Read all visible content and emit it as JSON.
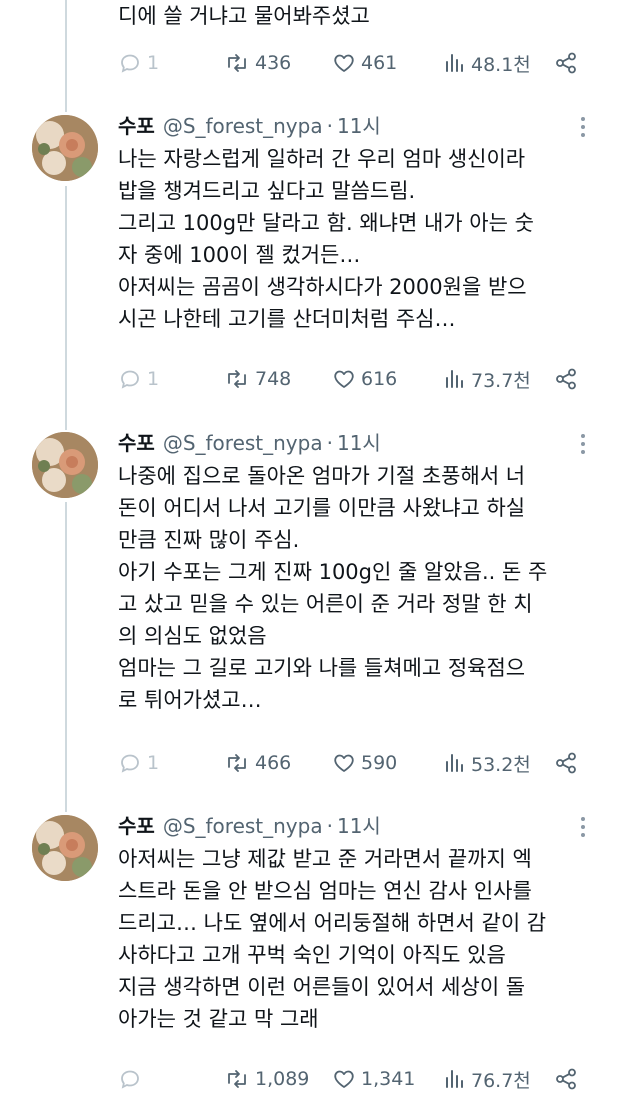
{
  "thread_tail": {
    "text": "디에 쓸 거냐고 물어봐주셨고",
    "metrics": {
      "replies": "1",
      "retweets": "436",
      "likes": "461",
      "views": "48.1천"
    }
  },
  "tweets": [
    {
      "author_name": "수포",
      "handle": "@S_forest_nypa",
      "separator": "·",
      "time": "11시",
      "text": "나는 자랑스럽게 일하러 간 우리 엄마 생신이라\n밥을 챙겨드리고 싶다고 말씀드림.\n그리고 100g만 달라고 함. 왜냐면 내가 아는 숫\n자 중에 100이 젤 컸거든…\n아저씨는 곰곰이 생각하시다가 2000원을 받으\n시곤 나한테 고기를 산더미처럼 주심…",
      "metrics": {
        "replies": "1",
        "retweets": "748",
        "likes": "616",
        "views": "73.7천"
      }
    },
    {
      "author_name": "수포",
      "handle": "@S_forest_nypa",
      "separator": "·",
      "time": "11시",
      "text": "나중에 집으로 돌아온 엄마가 기절 초풍해서 너\n돈이 어디서 나서 고기를 이만큼 사왔냐고 하실\n만큼 진짜 많이 주심.\n아기 수포는 그게 진짜 100g인 줄 알았음.. 돈 주\n고 샀고 믿을 수 있는 어른이 준 거라 정말 한 치\n의 의심도 없었음\n엄마는 그 길로 고기와 나를 들쳐메고 정육점으\n로 튀어가셨고…",
      "metrics": {
        "replies": "1",
        "retweets": "466",
        "likes": "590",
        "views": "53.2천"
      }
    },
    {
      "author_name": "수포",
      "handle": "@S_forest_nypa",
      "separator": "·",
      "time": "11시",
      "text": "아저씨는 그냥 제값 받고 준 거라면서 끝까지 엑\n스트라 돈을 안 받으심 엄마는 연신 감사 인사를\n드리고… 나도 옆에서 어리둥절해 하면서 같이 감\n사하다고 고개 꾸벅 숙인 기억이 아직도 있음\n지금 생각하면 이런 어른들이 있어서 세상이 돌\n아가는 것 같고 막 그래",
      "metrics": {
        "replies": "",
        "retweets": "1,089",
        "likes": "1,341",
        "views": "76.7천"
      }
    }
  ],
  "colors": {
    "text": "#0f1419",
    "muted": "#536471",
    "thread_line": "#cfd9de"
  },
  "icons": [
    "reply-icon",
    "retweet-icon",
    "like-icon",
    "views-icon",
    "share-icon",
    "more-icon"
  ]
}
